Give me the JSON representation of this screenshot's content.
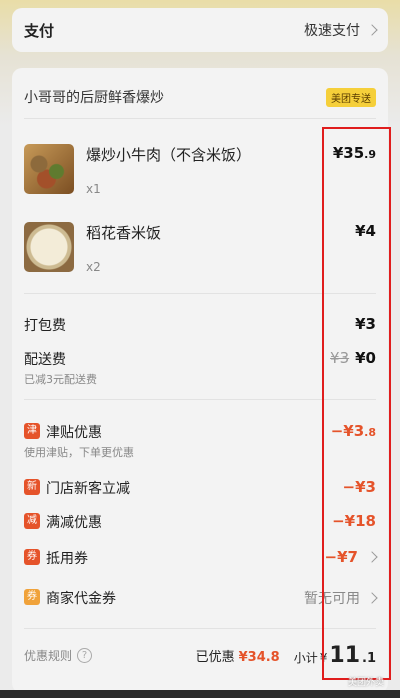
{
  "payment": {
    "label": "支付",
    "method": "极速支付"
  },
  "store": {
    "name": "小哥哥的后厨鲜香爆炒",
    "delivery_badge": "美团专送"
  },
  "items": [
    {
      "name": "爆炒小牛肉（不含米饭）",
      "qty": "x1",
      "price": "¥35",
      "price_decimal": ".9"
    },
    {
      "name": "稻花香米饭",
      "qty": "x2",
      "price": "¥4",
      "price_decimal": ""
    }
  ],
  "fees": {
    "packaging": {
      "label": "打包费",
      "value": "¥3"
    },
    "delivery": {
      "label": "配送费",
      "original": "¥3",
      "value": "¥0",
      "note": "已减3元配送费"
    }
  },
  "promotions": [
    {
      "icon": "津",
      "icon_color": "#e5532a",
      "label": "津贴优惠",
      "note": "使用津贴，下单更优惠",
      "value": "−¥3",
      "value_decimal": ".8"
    },
    {
      "icon": "新",
      "icon_color": "#e5532a",
      "label": "门店新客立减",
      "value": "−¥3"
    },
    {
      "icon": "减",
      "icon_color": "#e5532a",
      "label": "满减优惠",
      "value": "−¥18"
    },
    {
      "icon": "券",
      "icon_color": "#e5532a",
      "label": "抵用券",
      "value": "−¥7"
    },
    {
      "icon": "券",
      "icon_color": "#f0a23a",
      "label": "商家代金券",
      "value": "暂无可用"
    }
  ],
  "footer": {
    "rules_label": "优惠规则",
    "help_icon": "?",
    "saved_label": "已优惠",
    "saved_amount": "¥34.8",
    "subtotal_label": "小计",
    "subtotal_yen": "¥",
    "subtotal_int": "11",
    "subtotal_dec": ".1"
  },
  "watermark": "美团外卖",
  "colors": {
    "accent_red": "#e5532a",
    "highlight_red": "#e01d1d",
    "badge_yellow": "#f5cf3a"
  }
}
